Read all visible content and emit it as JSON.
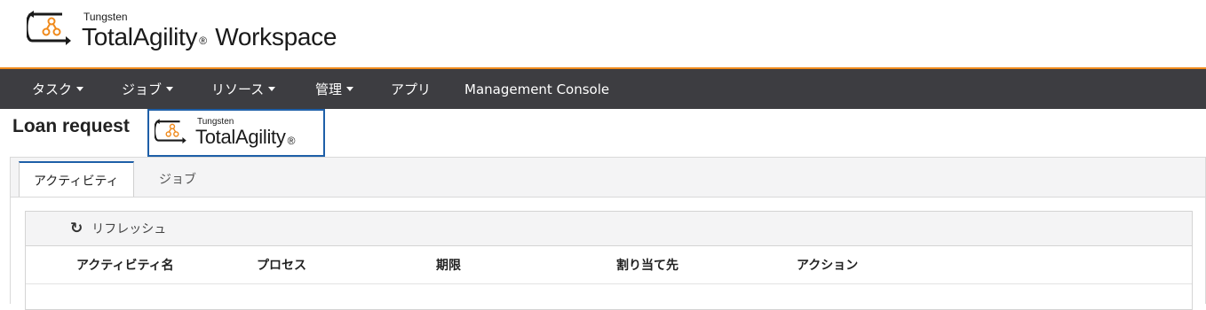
{
  "header": {
    "brand_small": "Tungsten",
    "brand_name": "TotalAgility",
    "brand_reg": "®",
    "brand_suffix": "Workspace",
    "logo_icon": "workflow-logo-icon"
  },
  "nav": {
    "items": [
      {
        "label": "タスク",
        "has_caret": true
      },
      {
        "label": "ジョブ",
        "has_caret": true
      },
      {
        "label": "リソース",
        "has_caret": true
      },
      {
        "label": "管理",
        "has_caret": true
      },
      {
        "label": "アプリ",
        "has_caret": false
      },
      {
        "label": "Management Console",
        "has_caret": false
      }
    ]
  },
  "page": {
    "title": "Loan request",
    "logo_small": "Tungsten",
    "logo_name": "TotalAgility",
    "logo_reg": "®"
  },
  "tabs": [
    {
      "label": "アクティビティ",
      "active": true
    },
    {
      "label": "ジョブ",
      "active": false
    }
  ],
  "toolbar": {
    "refresh_label": "リフレッシュ",
    "refresh_icon": "refresh-icon"
  },
  "table": {
    "columns": [
      "アクティビティ名",
      "プロセス",
      "期限",
      "割り当て先",
      "アクション"
    ],
    "rows": []
  },
  "colors": {
    "accent": "#f08a1c",
    "nav_bg": "#3d3d41",
    "tab_active_border": "#1e5fa8"
  }
}
